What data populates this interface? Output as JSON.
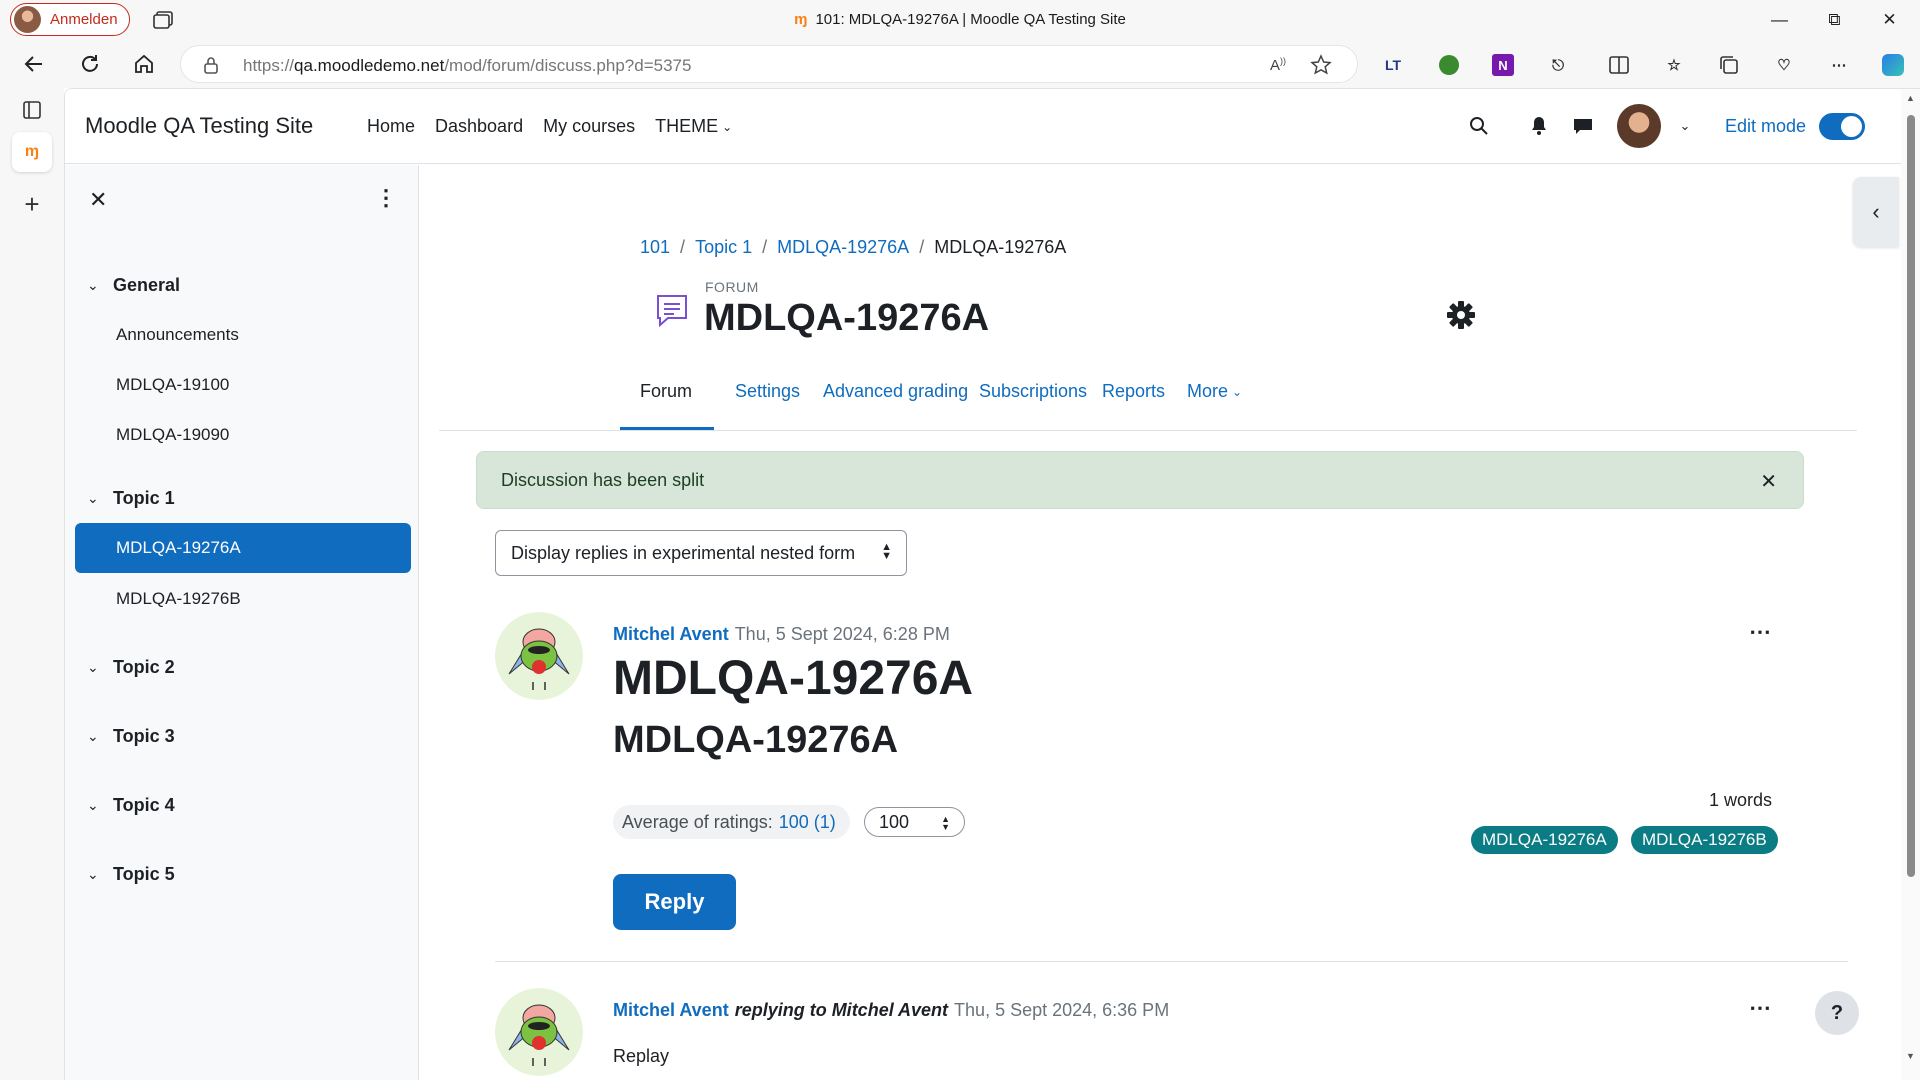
{
  "browser": {
    "profile_label": "Anmelden",
    "window_title": "101: MDLQA-19276A | Moodle QA Testing Site",
    "url_prefix": "https://",
    "url_host": "qa.moodledemo.net",
    "url_path": "/mod/forum/discuss.php?d=5375"
  },
  "navbar": {
    "site_name": "Moodle QA Testing Site",
    "links": [
      "Home",
      "Dashboard",
      "My courses",
      "THEME"
    ],
    "edit_mode_label": "Edit mode"
  },
  "course_index": {
    "sections": [
      {
        "title": "General",
        "items": [
          "Announcements",
          "MDLQA-19100",
          "MDLQA-19090"
        ]
      },
      {
        "title": "Topic 1",
        "items": [
          "MDLQA-19276A",
          "MDLQA-19276B"
        ],
        "active_item": "MDLQA-19276A"
      },
      {
        "title": "Topic 2",
        "items": []
      },
      {
        "title": "Topic 3",
        "items": []
      },
      {
        "title": "Topic 4",
        "items": []
      },
      {
        "title": "Topic 5",
        "items": []
      }
    ]
  },
  "breadcrumb": [
    "101",
    "Topic 1",
    "MDLQA-19276A",
    "MDLQA-19276A"
  ],
  "page_header": {
    "kicker": "FORUM",
    "title": "MDLQA-19276A"
  },
  "tabs": [
    {
      "label": "Forum",
      "active": true
    },
    {
      "label": "Settings",
      "active": false
    },
    {
      "label": "Advanced grading",
      "active": false
    },
    {
      "label": "Subscriptions",
      "active": false
    },
    {
      "label": "Reports",
      "active": false
    },
    {
      "label": "More",
      "active": false
    }
  ],
  "alert": {
    "message": "Discussion has been split"
  },
  "display_mode": {
    "selected": "Display replies in experimental nested form"
  },
  "posts": [
    {
      "author": "Mitchel Avent",
      "date": "Thu, 5 Sept 2024, 6:28 PM",
      "subject": "MDLQA-19276A",
      "body_heading": "MDLQA-19276A",
      "word_count": "1 words",
      "rating_label": "Average of ratings:",
      "rating_value": "100 (1)",
      "rating_selected": "100",
      "tags": [
        "MDLQA-19276A",
        "MDLQA-19276B"
      ],
      "reply_label": "Reply"
    },
    {
      "author": "Mitchel Avent",
      "replying_to": "replying to Mitchel Avent",
      "date": "Thu, 5 Sept 2024, 6:36 PM",
      "body": "Replay"
    }
  ],
  "help_label": "?",
  "colors": {
    "primary": "#0f6cbf",
    "tag": "#0c7c84",
    "alert_bg": "#d7e6d9",
    "profile_red": "#c42b1c"
  }
}
